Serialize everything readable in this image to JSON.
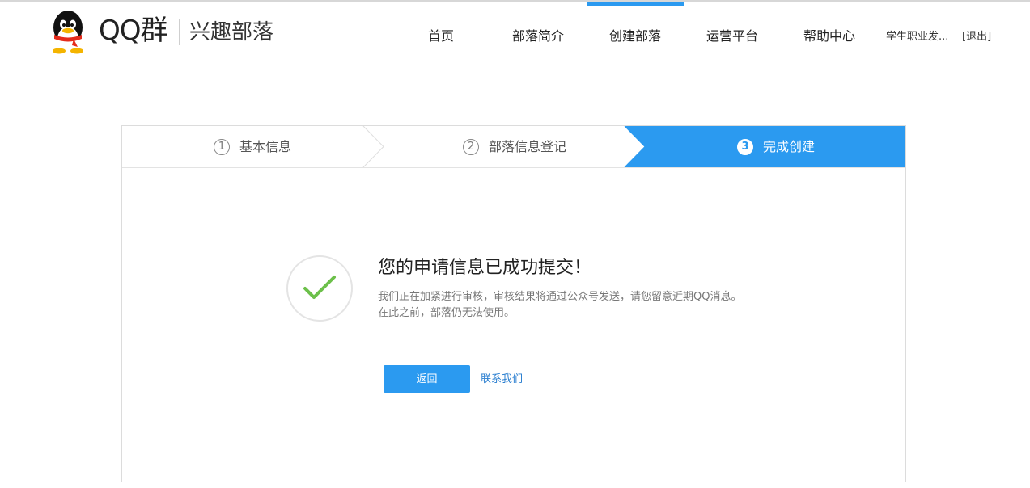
{
  "header": {
    "brand": "QQ群",
    "subtitle": "兴趣部落",
    "nav": [
      {
        "label": "首页",
        "active": false
      },
      {
        "label": "部落简介",
        "active": false
      },
      {
        "label": "创建部落",
        "active": true
      },
      {
        "label": "运营平台",
        "active": false
      },
      {
        "label": "帮助中心",
        "active": false
      }
    ],
    "user_name": "学生职业发...",
    "logout_label": "[退出]",
    "accent_color": "#2b9af0"
  },
  "steps": [
    {
      "num": "1",
      "label": "基本信息",
      "active": false
    },
    {
      "num": "2",
      "label": "部落信息登记",
      "active": false
    },
    {
      "num": "3",
      "label": "完成创建",
      "active": true
    }
  ],
  "result": {
    "icon": "check-icon",
    "title": "您的申请信息已成功提交！",
    "message_line1": "我们正在加紧进行审核，审核结果将通过公众号发送，请您留意近期QQ消息。",
    "message_line2": "在此之前，部落仍无法使用。",
    "back_label": "返回",
    "contact_label": "联系我们"
  }
}
